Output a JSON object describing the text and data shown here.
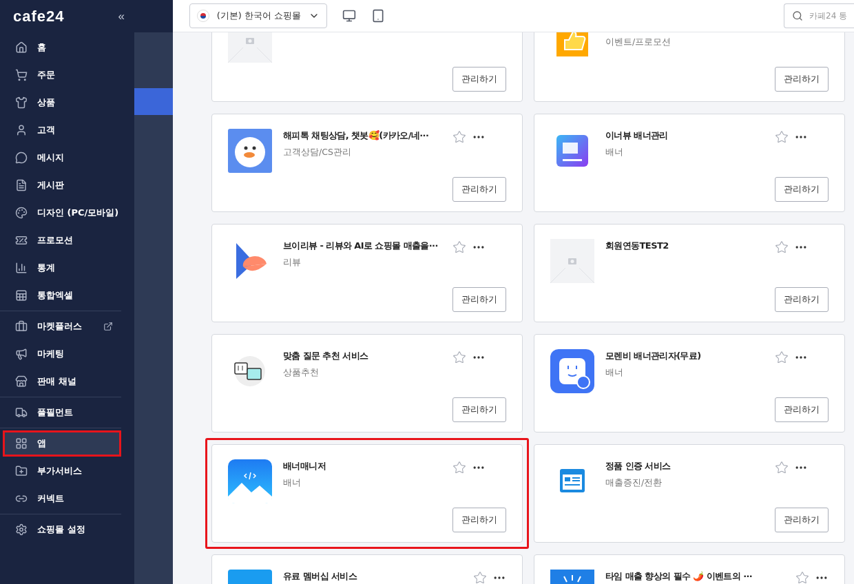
{
  "sidebar": {
    "logo": "cafe24",
    "collapse": "«",
    "groups": [
      [
        {
          "label": "홈",
          "selected": false,
          "highlighted": false,
          "external": false
        },
        {
          "label": "주문",
          "selected": false,
          "highlighted": false,
          "external": false
        },
        {
          "label": "상품",
          "selected": false,
          "highlighted": false,
          "external": false
        },
        {
          "label": "고객",
          "selected": false,
          "highlighted": false,
          "external": false
        },
        {
          "label": "메시지",
          "selected": false,
          "highlighted": false,
          "external": false
        },
        {
          "label": "게시판",
          "selected": false,
          "highlighted": false,
          "external": false
        },
        {
          "label": "디자인 (PC/모바일)",
          "selected": false,
          "highlighted": false,
          "external": false
        },
        {
          "label": "프로모션",
          "selected": false,
          "highlighted": false,
          "external": false
        },
        {
          "label": "통계",
          "selected": false,
          "highlighted": false,
          "external": false
        },
        {
          "label": "통합엑셀",
          "selected": false,
          "highlighted": false,
          "external": false
        }
      ],
      [
        {
          "label": "마켓플러스",
          "selected": false,
          "highlighted": false,
          "external": true
        },
        {
          "label": "마케팅",
          "selected": false,
          "highlighted": false,
          "external": false
        },
        {
          "label": "판매 채널",
          "selected": false,
          "highlighted": false,
          "external": false
        }
      ],
      [
        {
          "label": "풀필먼트",
          "selected": false,
          "highlighted": false,
          "external": false
        }
      ],
      [
        {
          "label": "앱",
          "selected": true,
          "highlighted": true,
          "external": false
        },
        {
          "label": "부가서비스",
          "selected": false,
          "highlighted": false,
          "external": false
        },
        {
          "label": "커넥트",
          "selected": false,
          "highlighted": false,
          "external": false
        }
      ],
      [
        {
          "label": "쇼핑몰 설정",
          "selected": false,
          "highlighted": false,
          "external": false
        }
      ]
    ]
  },
  "subnav": [
    {
      "selected": false
    },
    {
      "selected": true
    },
    {
      "selected": false
    }
  ],
  "topbar": {
    "store_select": "(기본) 한국어 쇼핑몰",
    "device_views": [
      {
        "kind": "desktop"
      },
      {
        "kind": "tablet"
      }
    ],
    "search": {
      "placeholder": "카페24 통"
    }
  },
  "apps": [
    {
      "highlighted": false,
      "button": "관리하기"
    },
    {
      "category": "이벤트/프로모션",
      "highlighted": false,
      "button": "관리하기"
    },
    {
      "title": "해피톡 채팅상담, 챗봇🥰(카카오/네···",
      "category": "고객상담/CS관리",
      "highlighted": false,
      "button": "관리하기"
    },
    {
      "title": "이너뷰 배너관리",
      "category": "배너",
      "highlighted": false,
      "button": "관리하기"
    },
    {
      "title": "브이리뷰 - 리뷰와 AI로 쇼핑몰 매출을···",
      "category": "리뷰",
      "highlighted": false,
      "button": "관리하기"
    },
    {
      "title": "회원연동TEST2",
      "highlighted": false,
      "button": "관리하기"
    },
    {
      "title": "맞춤 질문 추천 서비스",
      "category": "상품추천",
      "highlighted": false,
      "button": "관리하기"
    },
    {
      "title": "모렌비 배너관리자(무료)",
      "category": "배너",
      "highlighted": false,
      "button": "관리하기"
    },
    {
      "title": "배너매니저",
      "category": "배너",
      "highlighted": true,
      "button": "관리하기"
    },
    {
      "title": "정품 인증 서비스",
      "category": "매출증진/전환",
      "highlighted": false,
      "button": "관리하기"
    },
    {
      "title": "유료 멤버십 서비스",
      "highlighted": false
    },
    {
      "title": "타임 매출 향상의 필수 🌶️ 이벤트의 ···",
      "highlighted": false
    }
  ]
}
